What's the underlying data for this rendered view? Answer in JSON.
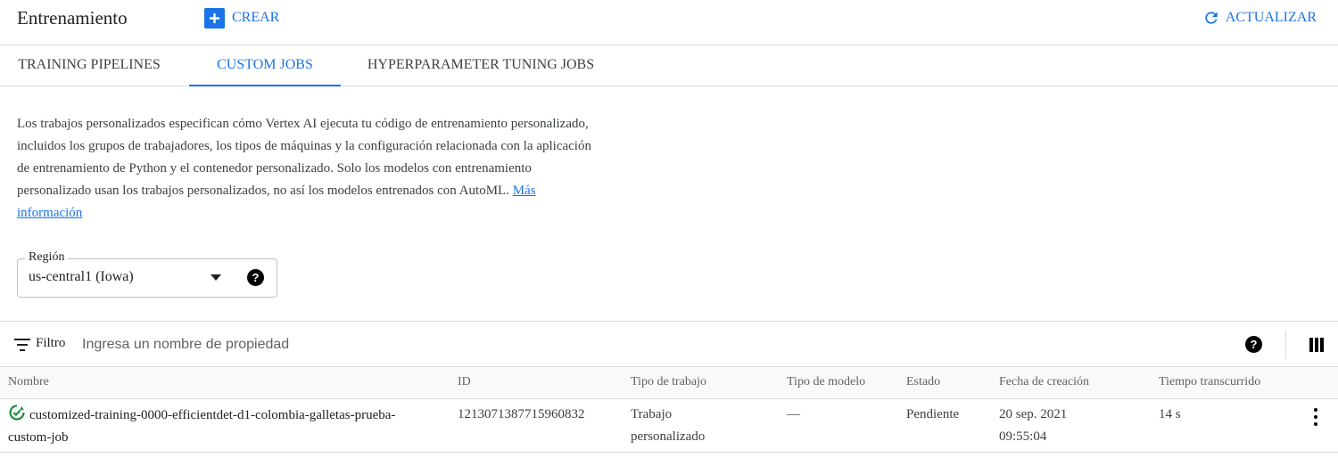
{
  "header": {
    "title": "Entrenamiento",
    "create_label": "CREAR",
    "refresh_label": "ACTUALIZAR"
  },
  "tabs": [
    {
      "label": "TRAINING PIPELINES",
      "active": false
    },
    {
      "label": "CUSTOM JOBS",
      "active": true
    },
    {
      "label": "HYPERPARAMETER TUNING JOBS",
      "active": false
    }
  ],
  "description": {
    "text": "Los trabajos personalizados especifican cómo Vertex AI ejecuta tu código de entrenamiento personalizado, incluidos los grupos de trabajadores, los tipos de máquinas y la configuración relacionada con la aplicación de entrenamiento de Python y el contenedor personalizado. Solo los modelos con entrenamiento personalizado usan los trabajos personalizados, no así los modelos entrenados con AutoML.",
    "link_label": "Más información"
  },
  "region": {
    "label": "Región",
    "value": "us-central1 (Iowa)"
  },
  "filter": {
    "label": "Filtro",
    "placeholder": "Ingresa un nombre de propiedad"
  },
  "table": {
    "columns": [
      "Nombre",
      "ID",
      "Tipo de trabajo",
      "Tipo de modelo",
      "Estado",
      "Fecha de creación",
      "Tiempo transcurrido"
    ],
    "rows": [
      {
        "name": "customized-training-0000-efficientdet-d1-colombia-galletas-prueba-custom-job",
        "id": "1213071387715960832",
        "job_type": "Trabajo personalizado",
        "model_type": "—",
        "status": "Pendiente",
        "created": "20 sep. 2021 09:55:04",
        "elapsed": "14 s"
      }
    ]
  },
  "colors": {
    "accent": "#1a73e8",
    "status_ok": "#1e8e3e",
    "divider": "#dadce0"
  },
  "icons": {
    "create": "plus-box-icon",
    "refresh": "refresh-icon",
    "region_dropdown": "arrow-drop-down-icon",
    "help": "help-icon",
    "filter": "filter-list-icon",
    "columns": "view-columns-icon",
    "status": "status-ok-icon",
    "row_menu": "more-vert-icon"
  }
}
